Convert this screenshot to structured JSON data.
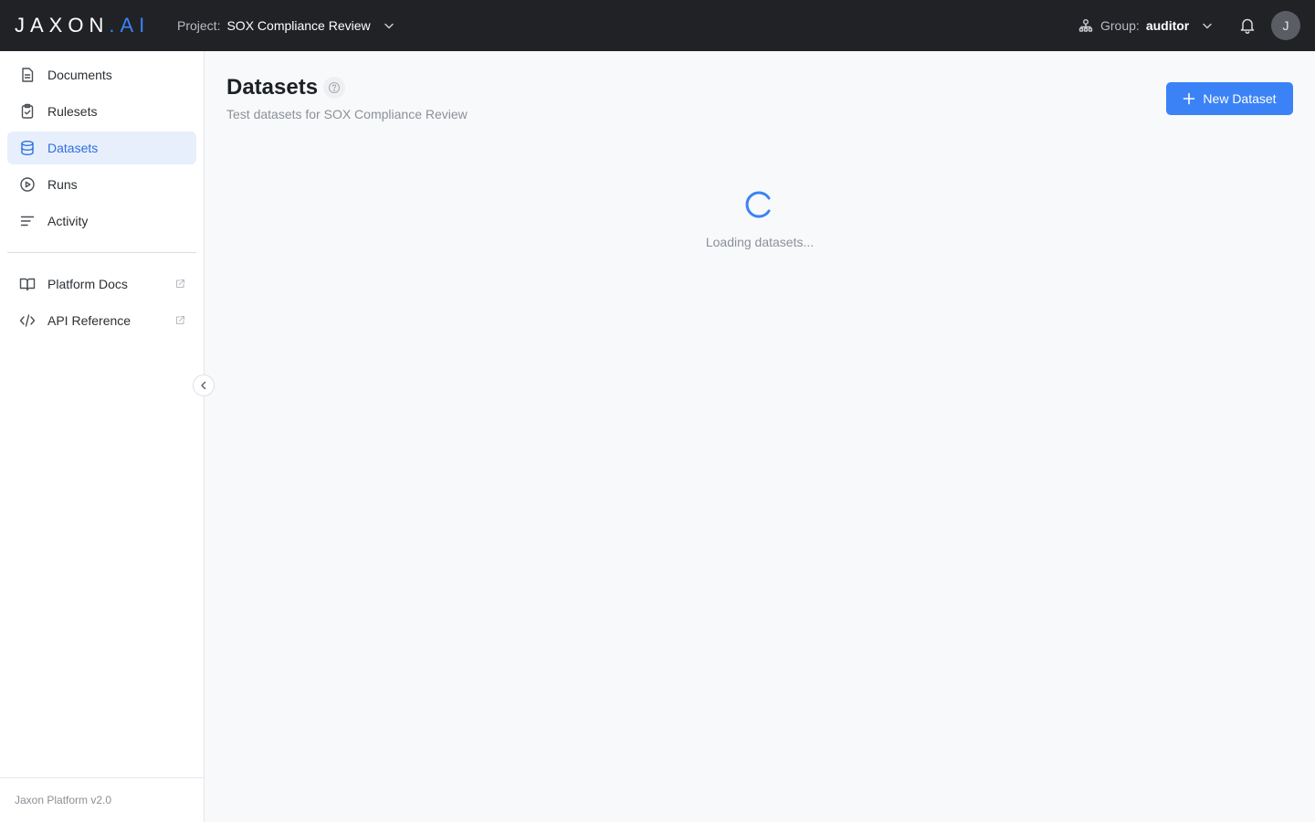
{
  "header": {
    "logo_main": "JAXON",
    "logo_dot": ".",
    "logo_suffix": "AI",
    "project_label": "Project:",
    "project_value": "SOX Compliance Review",
    "group_label": "Group:",
    "group_value": "auditor",
    "avatar_initial": "J"
  },
  "sidebar": {
    "items": [
      {
        "label": "Documents",
        "icon": "document-icon"
      },
      {
        "label": "Rulesets",
        "icon": "clipboard-check-icon"
      },
      {
        "label": "Datasets",
        "icon": "database-icon",
        "active": true
      },
      {
        "label": "Runs",
        "icon": "play-circle-icon"
      },
      {
        "label": "Activity",
        "icon": "lines-icon"
      }
    ],
    "links": [
      {
        "label": "Platform Docs",
        "icon": "book-icon"
      },
      {
        "label": "API Reference",
        "icon": "code-icon"
      }
    ],
    "footer": "Jaxon Platform v2.0"
  },
  "main": {
    "title": "Datasets",
    "subtitle": "Test datasets for SOX Compliance Review",
    "new_button_label": "New Dataset",
    "loading_text": "Loading datasets..."
  },
  "colors": {
    "topbar": "#202225",
    "accent": "#3b82f6",
    "active_bg": "#e8effc",
    "active_text": "#2d6fe0"
  }
}
